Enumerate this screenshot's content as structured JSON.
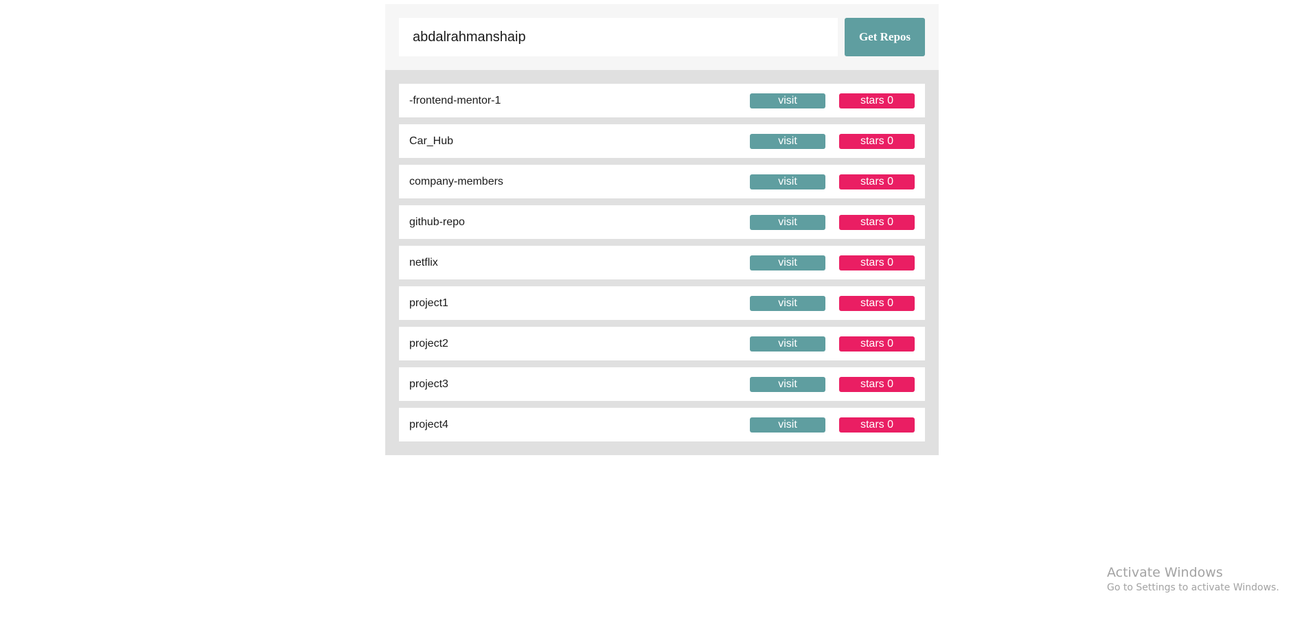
{
  "search": {
    "value": "abdalrahmanshaip",
    "button_label": "Get Repos"
  },
  "repos": [
    {
      "name": "-frontend-mentor-1",
      "visit_label": "visit",
      "stars_label": "stars 0"
    },
    {
      "name": "Car_Hub",
      "visit_label": "visit",
      "stars_label": "stars 0"
    },
    {
      "name": "company-members",
      "visit_label": "visit",
      "stars_label": "stars 0"
    },
    {
      "name": "github-repo",
      "visit_label": "visit",
      "stars_label": "stars 0"
    },
    {
      "name": "netflix",
      "visit_label": "visit",
      "stars_label": "stars 0"
    },
    {
      "name": "project1",
      "visit_label": "visit",
      "stars_label": "stars 0"
    },
    {
      "name": "project2",
      "visit_label": "visit",
      "stars_label": "stars 0"
    },
    {
      "name": "project3",
      "visit_label": "visit",
      "stars_label": "stars 0"
    },
    {
      "name": "project4",
      "visit_label": "visit",
      "stars_label": "stars 0"
    }
  ],
  "watermark": {
    "title": "Activate Windows",
    "subtitle": "Go to Settings to activate Windows."
  },
  "colors": {
    "accent": "#5f9ea0",
    "stars": "#ea1e63"
  }
}
